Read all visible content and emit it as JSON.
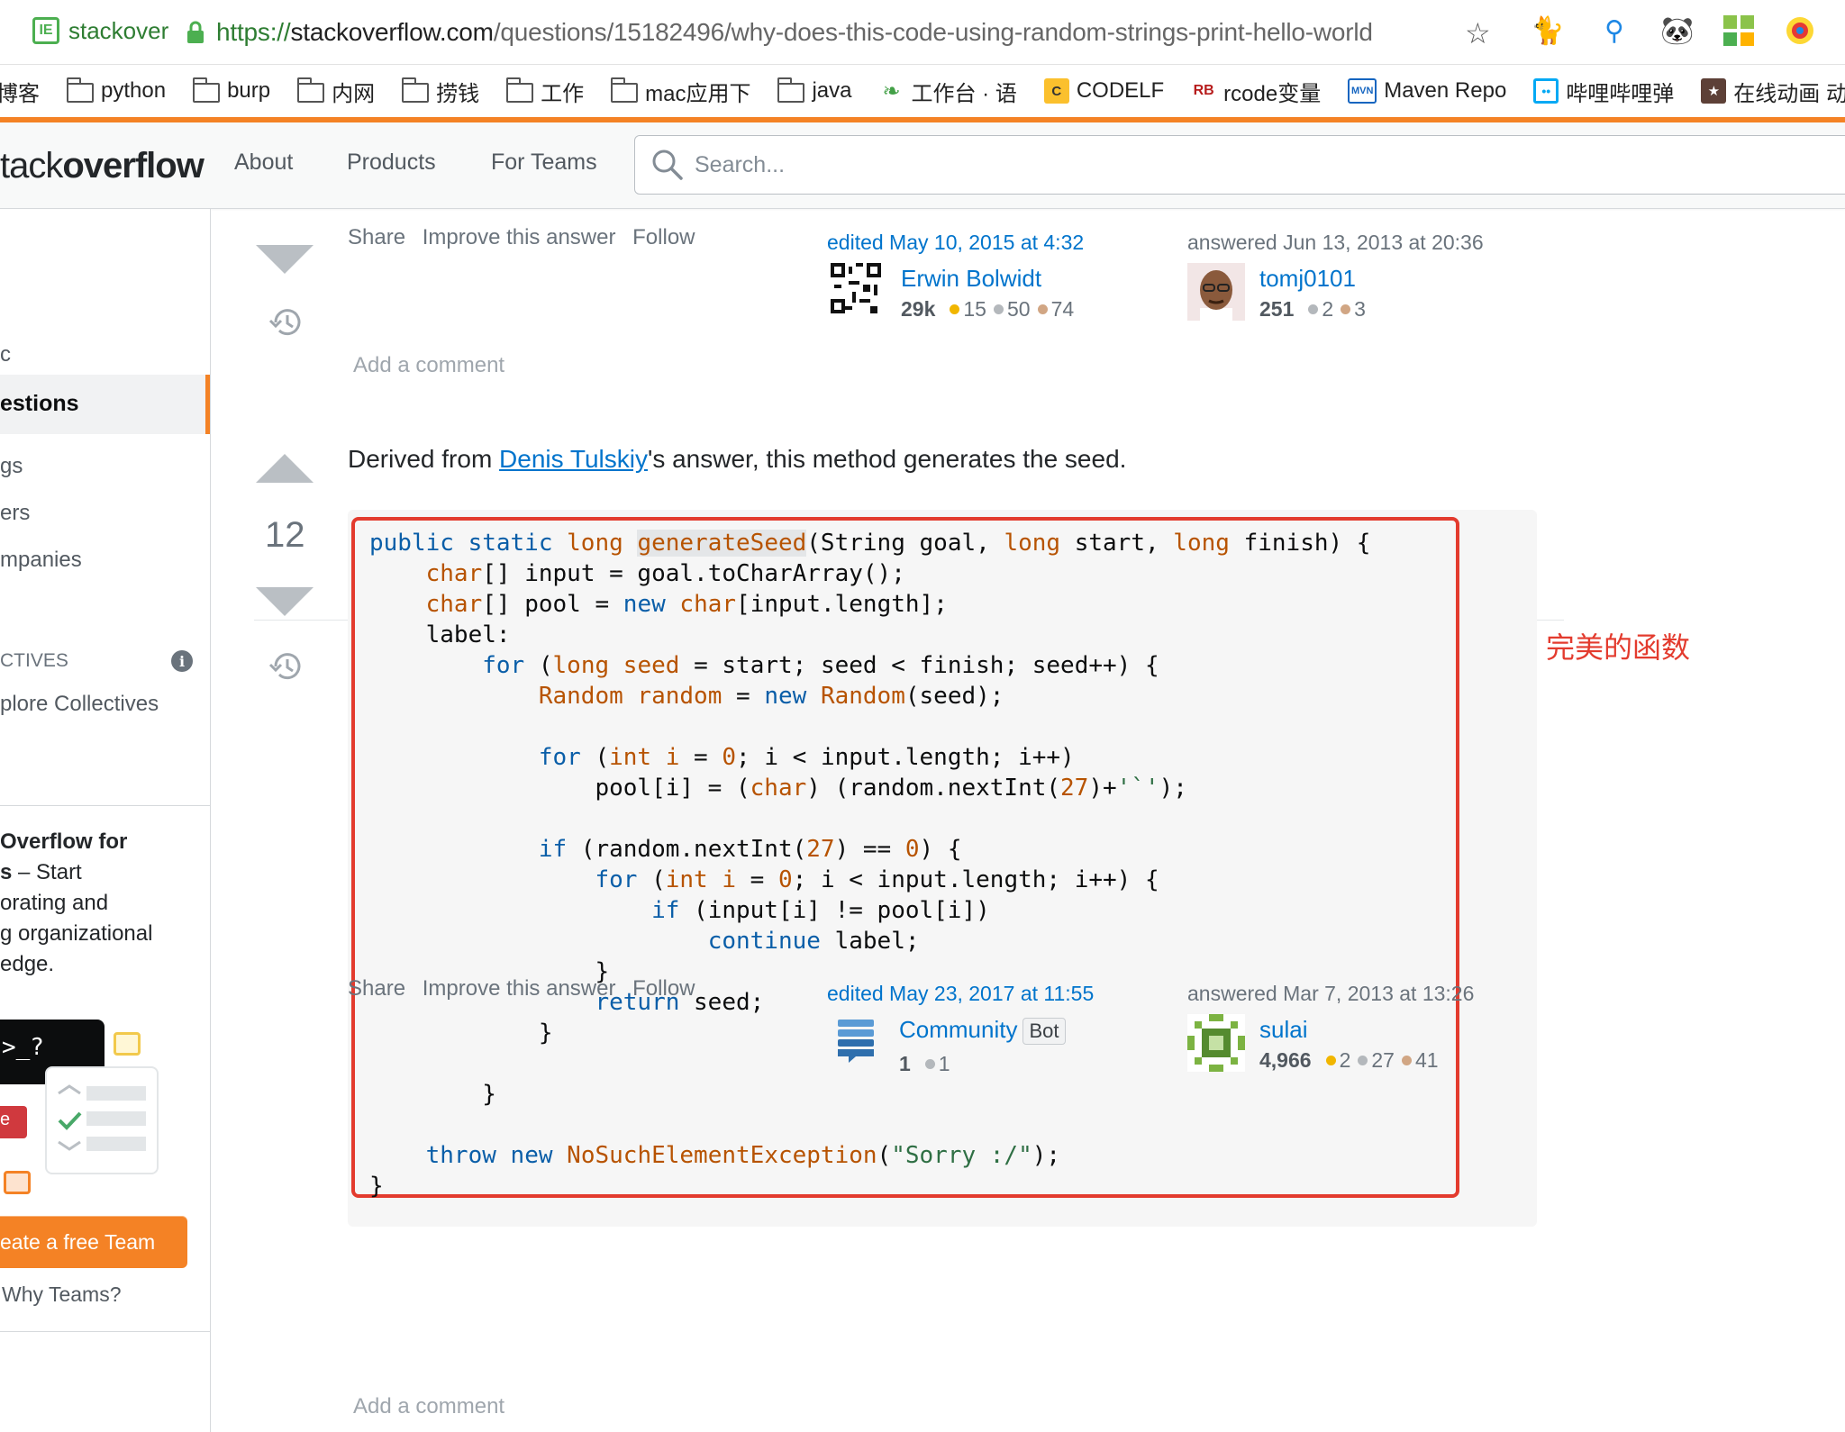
{
  "browser": {
    "tab_title": "stackover",
    "url_protocol": "https://",
    "url_host": "stackoverflow.com",
    "url_path": "/questions/15182496/why-does-this-code-using-random-strings-print-hello-world"
  },
  "bookmarks": [
    {
      "label": "博客",
      "icon": "none"
    },
    {
      "label": "python",
      "icon": "folder-icon"
    },
    {
      "label": "burp",
      "icon": "folder-icon"
    },
    {
      "label": "内网",
      "icon": "folder-icon"
    },
    {
      "label": "捞钱",
      "icon": "folder-icon"
    },
    {
      "label": "工作",
      "icon": "folder-icon"
    },
    {
      "label": "mac应用下",
      "icon": "folder-icon"
    },
    {
      "label": "java",
      "icon": "folder-icon"
    },
    {
      "label": "工作台 · 语",
      "icon": "leaf-icon"
    },
    {
      "label": "CODELF",
      "icon": "codelf-icon"
    },
    {
      "label": "rcode变量",
      "icon": "rb-icon"
    },
    {
      "label": "Maven Repo",
      "icon": "mvn-icon"
    },
    {
      "label": "哔哩哔哩弹",
      "icon": "bilibili-icon"
    },
    {
      "label": "在线动画 动",
      "icon": "anime-icon"
    }
  ],
  "header": {
    "logo_light": "tack",
    "logo_bold": "overflow",
    "nav": [
      "About",
      "Products",
      "For Teams"
    ],
    "search_placeholder": "Search..."
  },
  "sidebar": {
    "partial_item": "c",
    "active_item": "estions",
    "items": [
      "gs",
      "ers",
      "mpanies"
    ],
    "collectives_heading": "CTIVES",
    "explore": "plore Collectives",
    "teams_title": " Overflow for",
    "teams_bold2": "s",
    "teams_rest": " – Start",
    "teams_lines": [
      "orating and",
      "g organizational",
      "edge."
    ],
    "terminal_prompt": ">_?",
    "red_chip": "e",
    "cta": "eate a free Team",
    "why_teams": "Why Teams?"
  },
  "answer1": {
    "menu": [
      "Share",
      "Improve this answer",
      "Follow"
    ],
    "edited": "edited May 10, 2015 at 4:32",
    "editor": {
      "name": "Erwin Bolwidt",
      "rep": "29k",
      "gold": "15",
      "silver": "50",
      "bronze": "74"
    },
    "answered": "answered Jun 13, 2013 at 20:36",
    "author": {
      "name": "tomj0101",
      "rep": "251",
      "silver": "2",
      "bronze": "3"
    },
    "add_comment": "Add a comment"
  },
  "answer2": {
    "votes": "12",
    "text_before": "Derived from ",
    "link": "Denis Tulskiy",
    "text_after": "'s answer, this method generates the seed.",
    "menu": [
      "Share",
      "Improve this answer",
      "Follow"
    ],
    "edited": "edited May 23, 2017 at 11:55",
    "editor": {
      "name": "Community",
      "badge": "Bot",
      "rep": "1",
      "silver": "1"
    },
    "answered": "answered Mar 7, 2013 at 13:26",
    "author": {
      "name": "sulai",
      "rep": "4,966",
      "gold": "2",
      "silver": "27",
      "bronze": "41"
    },
    "add_comment": "Add a comment"
  },
  "annotation": "完美的函数",
  "colors": {
    "accent": "#f48225",
    "link": "#0074cc",
    "annotation_red": "#e33b2e"
  }
}
